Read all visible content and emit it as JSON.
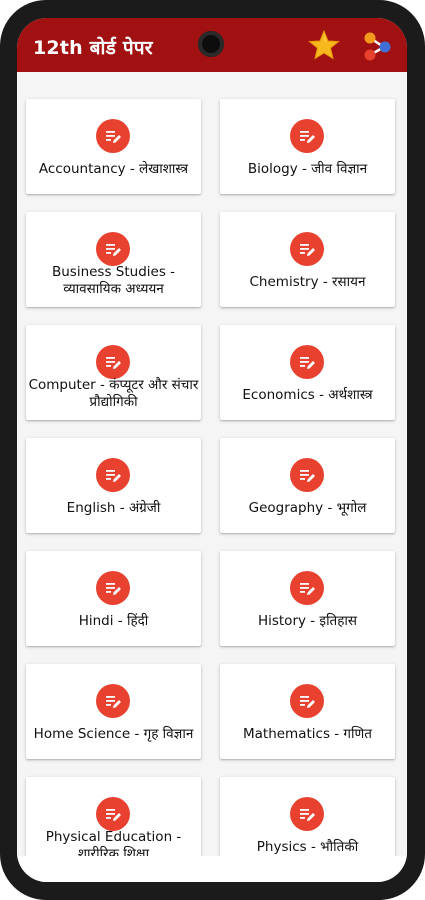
{
  "app_bar": {
    "title": "12th बोर्ड पेपर",
    "icons": [
      "star-icon",
      "share-icon"
    ],
    "color": "#a11111"
  },
  "subjects": [
    {
      "label": "Accountancy - लेखाशास्त्र"
    },
    {
      "label": "Biology - जीव विज्ञान"
    },
    {
      "label": "Business Studies - व्यावसायिक अध्ययन"
    },
    {
      "label": "Chemistry - रसायन"
    },
    {
      "label": "Computer - कंप्यूटर और संचार प्रौद्योगिकी"
    },
    {
      "label": "Economics - अर्थशास्त्र"
    },
    {
      "label": "English - अंग्रेजी"
    },
    {
      "label": "Geography - भूगोल"
    },
    {
      "label": "Hindi - हिंदी"
    },
    {
      "label": "History - इतिहास"
    },
    {
      "label": "Home Science - गृह विज्ञान"
    },
    {
      "label": "Mathematics - गणित"
    },
    {
      "label": "Physical Education - शारीरिक शिक्षा"
    },
    {
      "label": "Physics - भौतिकी"
    }
  ],
  "card_icon": "edit-note-icon",
  "accent": "#e8412f"
}
